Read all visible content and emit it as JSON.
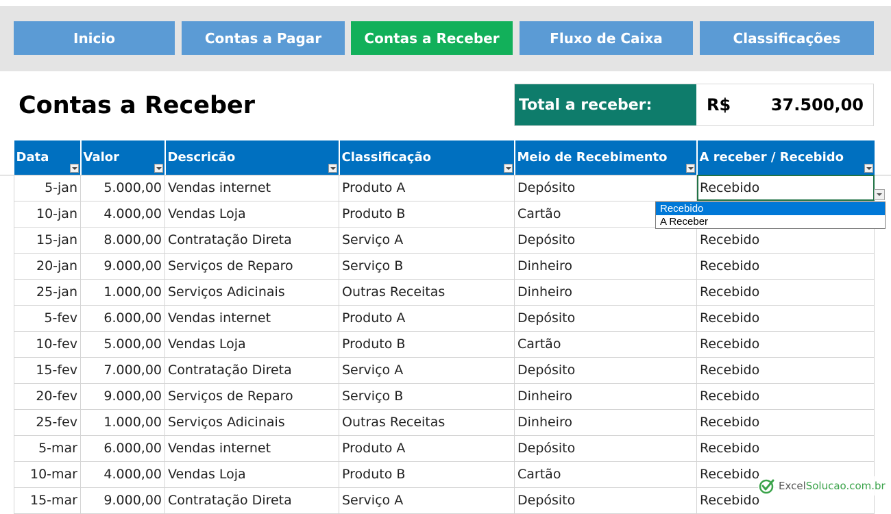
{
  "nav": {
    "buttons": [
      {
        "label": "Inicio"
      },
      {
        "label": "Contas a Pagar"
      },
      {
        "label": "Contas a Receber"
      },
      {
        "label": "Fluxo de Caixa"
      },
      {
        "label": "Classificações"
      }
    ],
    "active_index": 2
  },
  "page": {
    "title": "Contas a Receber"
  },
  "total": {
    "label": "Total a receber:",
    "currency": "R$",
    "value": "37.500,00"
  },
  "table": {
    "headers": [
      "Data",
      "Valor",
      "Descricão",
      "Classificação",
      "Meio de Recebimento",
      "A receber / Recebido"
    ],
    "rows": [
      [
        "5-jan",
        "5.000,00",
        "Vendas internet",
        "Produto A",
        "Depósito",
        "Recebido"
      ],
      [
        "10-jan",
        "4.000,00",
        "Vendas Loja",
        "Produto B",
        "Cartão",
        ""
      ],
      [
        "15-jan",
        "8.000,00",
        "Contratação Direta",
        "Serviço A",
        "Depósito",
        "Recebido"
      ],
      [
        "20-jan",
        "9.000,00",
        "Serviços de Reparo",
        "Serviço B",
        "Dinheiro",
        "Recebido"
      ],
      [
        "25-jan",
        "1.000,00",
        "Serviços Adicinais",
        "Outras Receitas",
        "Dinheiro",
        "Recebido"
      ],
      [
        "5-fev",
        "6.000,00",
        "Vendas internet",
        "Produto A",
        "Depósito",
        "Recebido"
      ],
      [
        "10-fev",
        "5.000,00",
        "Vendas Loja",
        "Produto B",
        "Cartão",
        "Recebido"
      ],
      [
        "15-fev",
        "7.000,00",
        "Contratação Direta",
        "Serviço A",
        "Depósito",
        "Recebido"
      ],
      [
        "20-fev",
        "9.000,00",
        "Serviços de Reparo",
        "Serviço B",
        "Dinheiro",
        "Recebido"
      ],
      [
        "25-fev",
        "1.000,00",
        "Serviços Adicinais",
        "Outras Receitas",
        "Dinheiro",
        "Recebido"
      ],
      [
        "5-mar",
        "6.000,00",
        "Vendas internet",
        "Produto A",
        "Depósito",
        "Recebido"
      ],
      [
        "10-mar",
        "4.000,00",
        "Vendas Loja",
        "Produto B",
        "Cartão",
        "Recebido"
      ],
      [
        "15-mar",
        "9.000,00",
        "Contratação Direta",
        "Serviço A",
        "Depósito",
        "Recebido"
      ]
    ]
  },
  "dropdown": {
    "options": [
      "Recebido",
      "A Receber"
    ],
    "highlighted": 0
  },
  "watermark": {
    "part1": "Excel",
    "part2": "Solucao.com.br"
  },
  "colors": {
    "nav": "#5b9bd5",
    "nav_active": "#12b05a",
    "header": "#0070c0",
    "total_label": "#0e7c6b"
  }
}
